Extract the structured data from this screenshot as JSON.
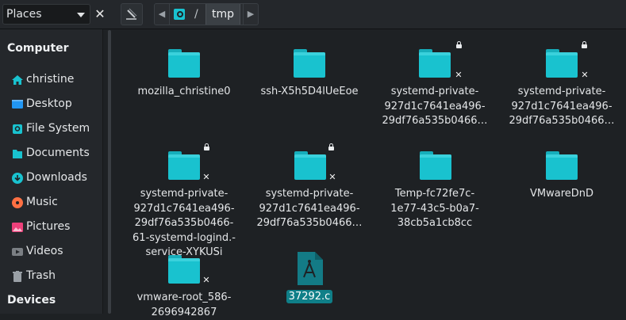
{
  "toolbar": {
    "places_label": "Places",
    "close_glyph": "✕",
    "breadcrumb": {
      "separator": "/",
      "current": "tmp"
    }
  },
  "sidebar": {
    "computer_header": "Computer",
    "devices_header": "Devices",
    "items": [
      {
        "label": "christine",
        "icon": "home-icon"
      },
      {
        "label": "Desktop",
        "icon": "desktop-icon"
      },
      {
        "label": "File System",
        "icon": "filesystem-icon"
      },
      {
        "label": "Documents",
        "icon": "documents-icon"
      },
      {
        "label": "Downloads",
        "icon": "downloads-icon"
      },
      {
        "label": "Music",
        "icon": "music-icon"
      },
      {
        "label": "Pictures",
        "icon": "pictures-icon"
      },
      {
        "label": "Videos",
        "icon": "videos-icon"
      },
      {
        "label": "Trash",
        "icon": "trash-icon"
      }
    ]
  },
  "files": [
    {
      "lines": [
        "mozilla_christine0"
      ],
      "type": "folder",
      "locked": false
    },
    {
      "lines": [
        "ssh-X5h5D4lUeEoe"
      ],
      "type": "folder",
      "locked": false
    },
    {
      "lines": [
        "systemd-private-",
        "927d1c7641ea496-",
        "29df76a535b0466…"
      ],
      "type": "folder",
      "locked": true
    },
    {
      "lines": [
        "systemd-private-",
        "927d1c7641ea496-",
        "29df76a535b0466…"
      ],
      "type": "folder",
      "locked": true
    },
    {
      "lines": [
        "systemd-private-",
        "927d1c7641ea496-",
        "29df76a535b0466-",
        "61-systemd-logind.-",
        "service-XYKUSi"
      ],
      "type": "folder",
      "locked": true
    },
    {
      "lines": [
        "systemd-private-",
        "927d1c7641ea496-",
        "29df76a535b0466…"
      ],
      "type": "folder",
      "locked": true
    },
    {
      "lines": [
        "Temp-fc72fe7c-",
        "1e77-43c5-b0a7-",
        "38cb5a1cb8cc"
      ],
      "type": "folder",
      "locked": false
    },
    {
      "lines": [
        "VMwareDnD"
      ],
      "type": "folder",
      "locked": false
    },
    {
      "lines": [
        "vmware-root_586-",
        "2696942867"
      ],
      "type": "folder",
      "locked": true
    },
    {
      "lines": [
        "37292.c"
      ],
      "type": "c-source-file",
      "selected": true
    }
  ],
  "colors": {
    "folder": "#19c2cf",
    "selection": "#0f7f88",
    "background": "#1e2124",
    "sidebar": "#24272b"
  }
}
